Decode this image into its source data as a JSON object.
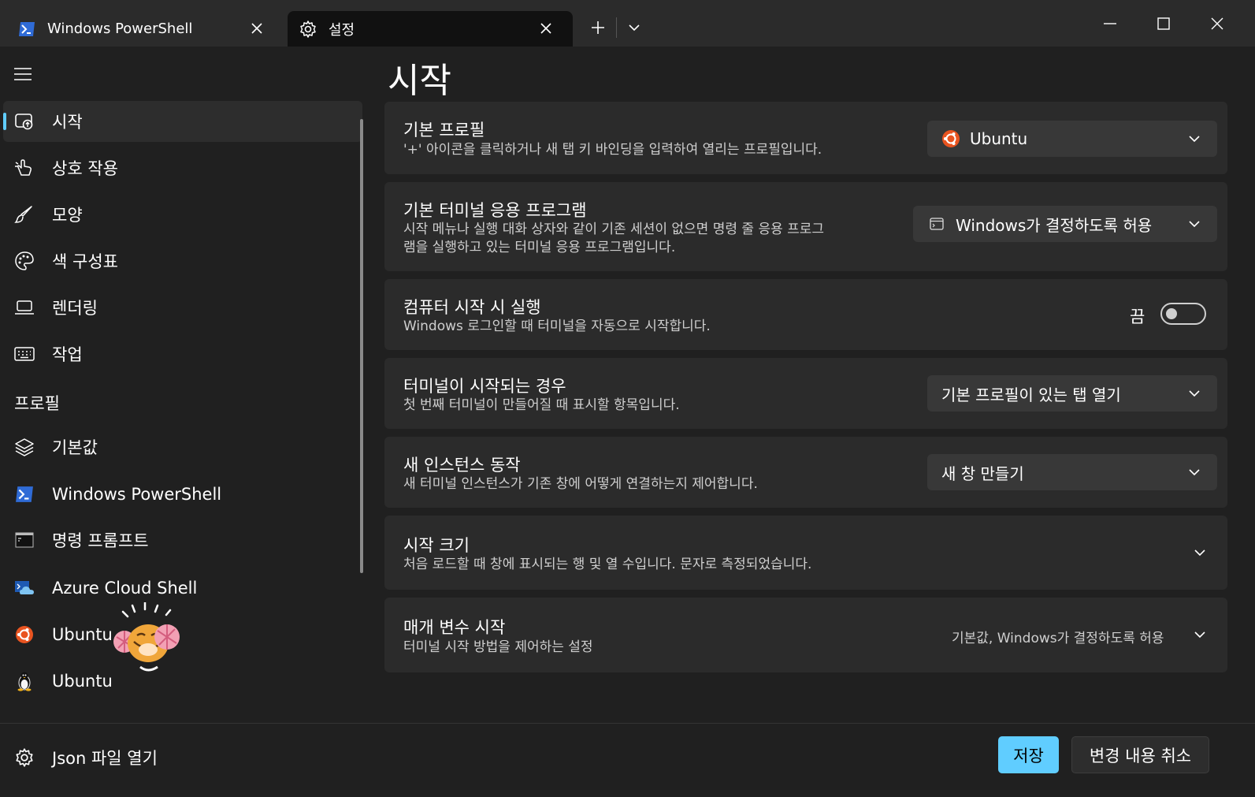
{
  "tabs": [
    {
      "label": "Windows PowerShell",
      "icon": "powershell-icon"
    },
    {
      "label": "설정",
      "icon": "gear-icon"
    }
  ],
  "sidebar": {
    "items": [
      {
        "label": "시작",
        "icon": "launch-icon",
        "active": true
      },
      {
        "label": "상호 작용",
        "icon": "pointer-icon"
      },
      {
        "label": "모양",
        "icon": "brush-icon"
      },
      {
        "label": "색 구성표",
        "icon": "palette-icon"
      },
      {
        "label": "렌더링",
        "icon": "monitor-icon"
      },
      {
        "label": "작업",
        "icon": "keyboard-icon"
      }
    ],
    "section_label": "프로필",
    "profiles": [
      {
        "label": "기본값",
        "icon": "layers-icon"
      },
      {
        "label": "Windows PowerShell",
        "icon": "powershell-icon"
      },
      {
        "label": "명령 프롬프트",
        "icon": "cmd-icon"
      },
      {
        "label": "Azure Cloud Shell",
        "icon": "azure-icon"
      },
      {
        "label": "Ubuntu",
        "icon": "ubuntu-icon"
      },
      {
        "label": "Ubuntu",
        "icon": "linux-icon"
      }
    ],
    "json_label": "Json 파일 열기"
  },
  "main": {
    "title": "시작",
    "settings": [
      {
        "title": "기본 프로필",
        "desc": "'+' 아이콘을 클릭하거나 새 탭 키 바인딩을 입력하여 열리는 프로필입니다.",
        "value": "Ubuntu"
      },
      {
        "title": "기본 터미널 응용 프로그램",
        "desc1": "시작 메뉴나 실행 대화 상자와 같이 기존 세션이 없으면 명령 줄 응용 프로그",
        "desc2": "램을 실행하고 있는 터미널 응용 프로그램입니다.",
        "value": "Windows가 결정하도록 허용"
      },
      {
        "title": "컴퓨터 시작 시 실행",
        "desc": "Windows 로그인할 때 터미널을 자동으로 시작합니다.",
        "toggle_label": "끔",
        "toggle_on": false
      },
      {
        "title": "터미널이 시작되는 경우",
        "desc": "첫 번째 터미널이 만들어질 때 표시할 항목입니다.",
        "value": "기본 프로필이 있는 탭 열기"
      },
      {
        "title": "새 인스턴스 동작",
        "desc": "새 터미널 인스턴스가 기존 창에 어떻게 연결하는지 제어합니다.",
        "value": "새 창 만들기"
      },
      {
        "title": "시작 크기",
        "desc": "처음 로드할 때 창에 표시되는 행 및 열 수입니다. 문자로 측정되었습니다."
      },
      {
        "title": "매개 변수 시작",
        "desc": "터미널 시작 방법을 제어하는 설정",
        "summary": "기본값, Windows가 결정하도록 허용"
      }
    ]
  },
  "footer": {
    "save_label": "저장",
    "cancel_label": "변경 내용 취소"
  },
  "colors": {
    "accent": "#60cdff",
    "background": "#202020",
    "card": "#2b2b2b"
  }
}
